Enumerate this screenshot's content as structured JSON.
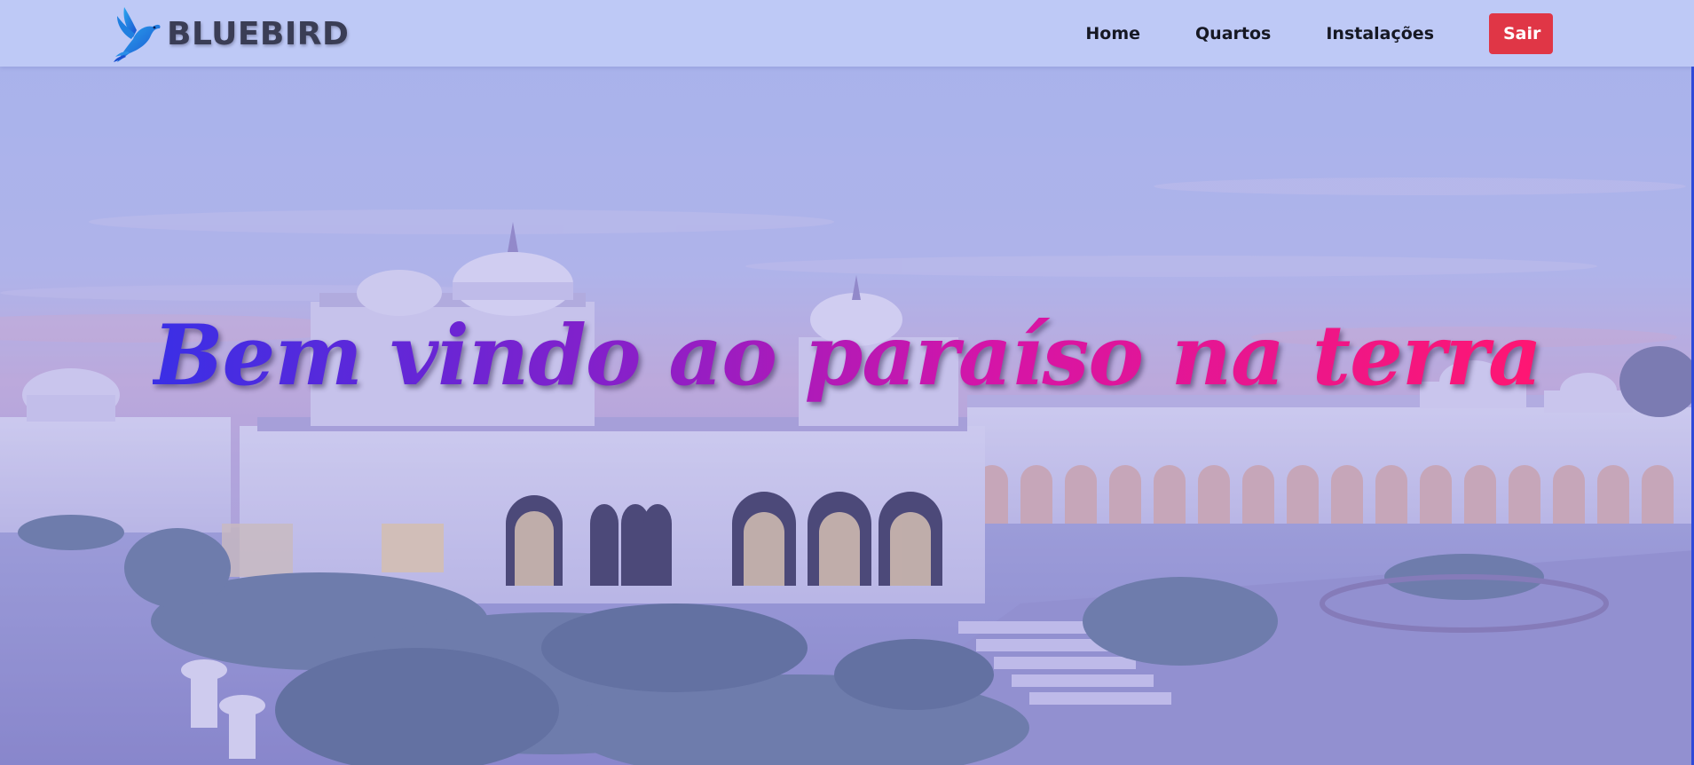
{
  "brand": {
    "name": "BLUEBIRD",
    "logo_icon": "bluebird-logo-icon"
  },
  "nav": {
    "items": [
      {
        "label": "Home"
      },
      {
        "label": "Quartos"
      },
      {
        "label": "Instalações"
      }
    ],
    "logout_label": "Sair"
  },
  "hero": {
    "title": "Bem vindo ao paraíso na terra",
    "background_image": "palace-hotel-at-dusk"
  },
  "colors": {
    "logout_button": "#e03646",
    "title_gradient_start": "#3a2fe6",
    "title_gradient_end": "#ff1672",
    "overlay": "#9aa6e0"
  }
}
